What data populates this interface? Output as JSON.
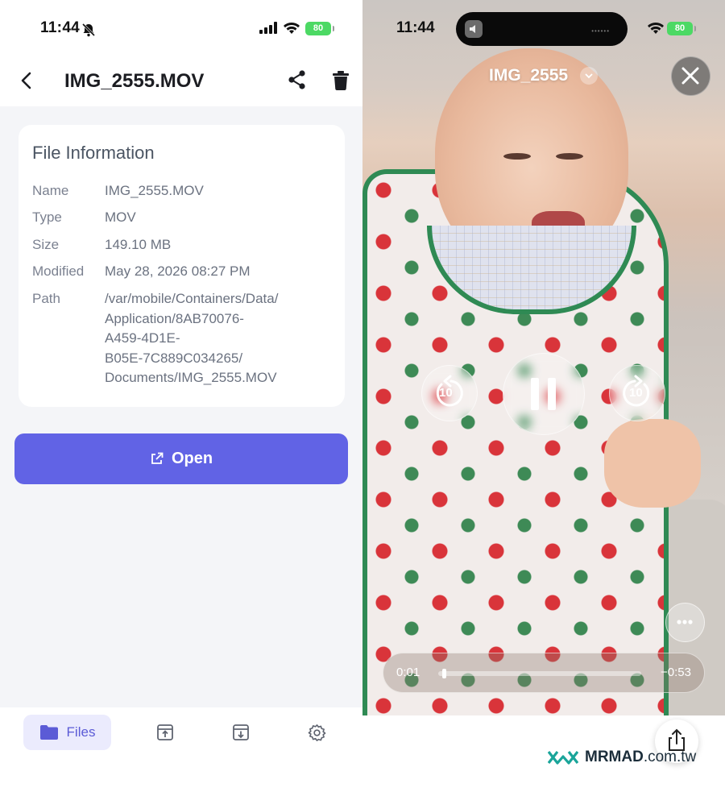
{
  "left_status": {
    "time": "11:44",
    "battery": "80"
  },
  "navbar": {
    "title": "IMG_2555.MOV"
  },
  "file_info": {
    "title": "File Information",
    "rows": [
      {
        "key": "Name",
        "value": "IMG_2555.MOV"
      },
      {
        "key": "Type",
        "value": "MOV"
      },
      {
        "key": "Size",
        "value": "149.10 MB"
      },
      {
        "key": "Modified",
        "value": "May 28, 2026 08:27 PM"
      },
      {
        "key": "Path",
        "value": "/var/mobile/Containers/Data/\nApplication/8AB70076-\nA459-4D1E-\nB05E-7C889C034265/\nDocuments/IMG_2555.MOV"
      }
    ]
  },
  "open_button": {
    "label": "Open"
  },
  "tabbar": {
    "files_label": "Files"
  },
  "accent": "#6163e5",
  "player": {
    "status_time": "11:44",
    "battery": "80",
    "title": "IMG_2555",
    "skip_back": "10",
    "skip_forward": "10",
    "elapsed": "0:01",
    "remaining": "−0:53",
    "progress": 0.02
  },
  "watermark": {
    "brand": "MRMAD",
    "domain": ".com.tw"
  }
}
